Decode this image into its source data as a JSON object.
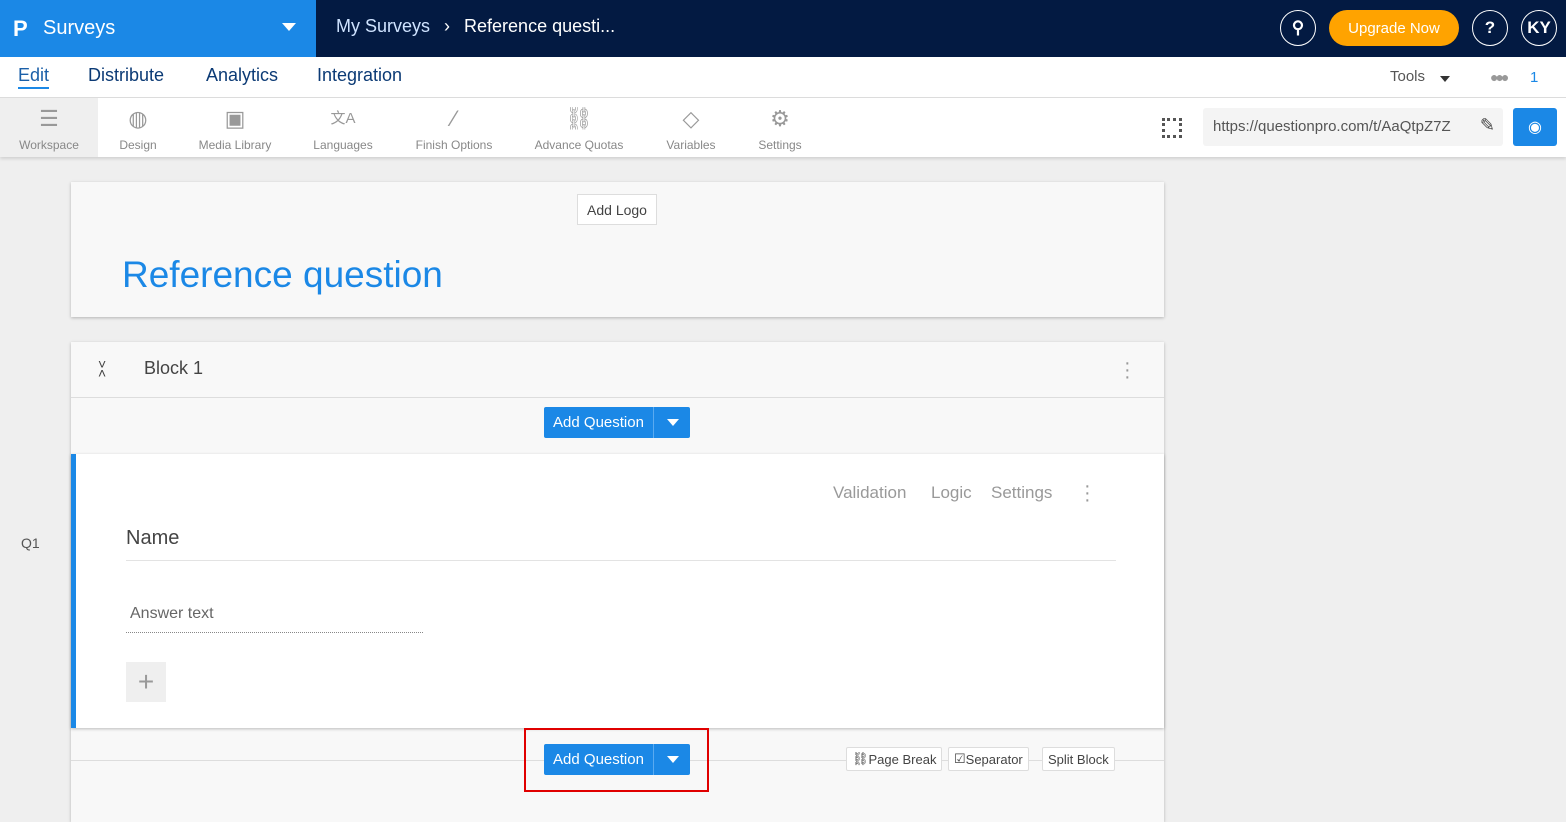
{
  "header": {
    "brand_logo": "P",
    "app_name": "Surveys",
    "breadcrumb": [
      "My Surveys",
      "Reference questi..."
    ],
    "upgrade_label": "Upgrade Now",
    "help": "?",
    "avatar": "KY"
  },
  "nav": {
    "tabs": [
      "Edit",
      "Distribute",
      "Analytics",
      "Integration"
    ],
    "active": "Edit",
    "tools_label": "Tools",
    "collaborators_count": "1"
  },
  "toolbar": {
    "items": [
      "Workspace",
      "Design",
      "Media Library",
      "Languages",
      "Finish Options",
      "Advance Quotas",
      "Variables",
      "Settings"
    ],
    "active": "Workspace",
    "survey_url": "https://questionpro.com/t/AaQtpZ7Z"
  },
  "survey": {
    "add_logo": "Add Logo",
    "title": "Reference question"
  },
  "block": {
    "name": "Block 1",
    "add_question": "Add Question",
    "question": {
      "number": "Q1",
      "text": "Name",
      "answer_placeholder": "Answer text",
      "actions": [
        "Validation",
        "Logic",
        "Settings"
      ]
    },
    "footer_actions": [
      "Page Break",
      "Separator",
      "Split Block"
    ]
  },
  "colors": {
    "brand": "#1b88e6",
    "topbar": "#031a42",
    "upgrade": "#ffa300",
    "highlight": "#e00000"
  }
}
